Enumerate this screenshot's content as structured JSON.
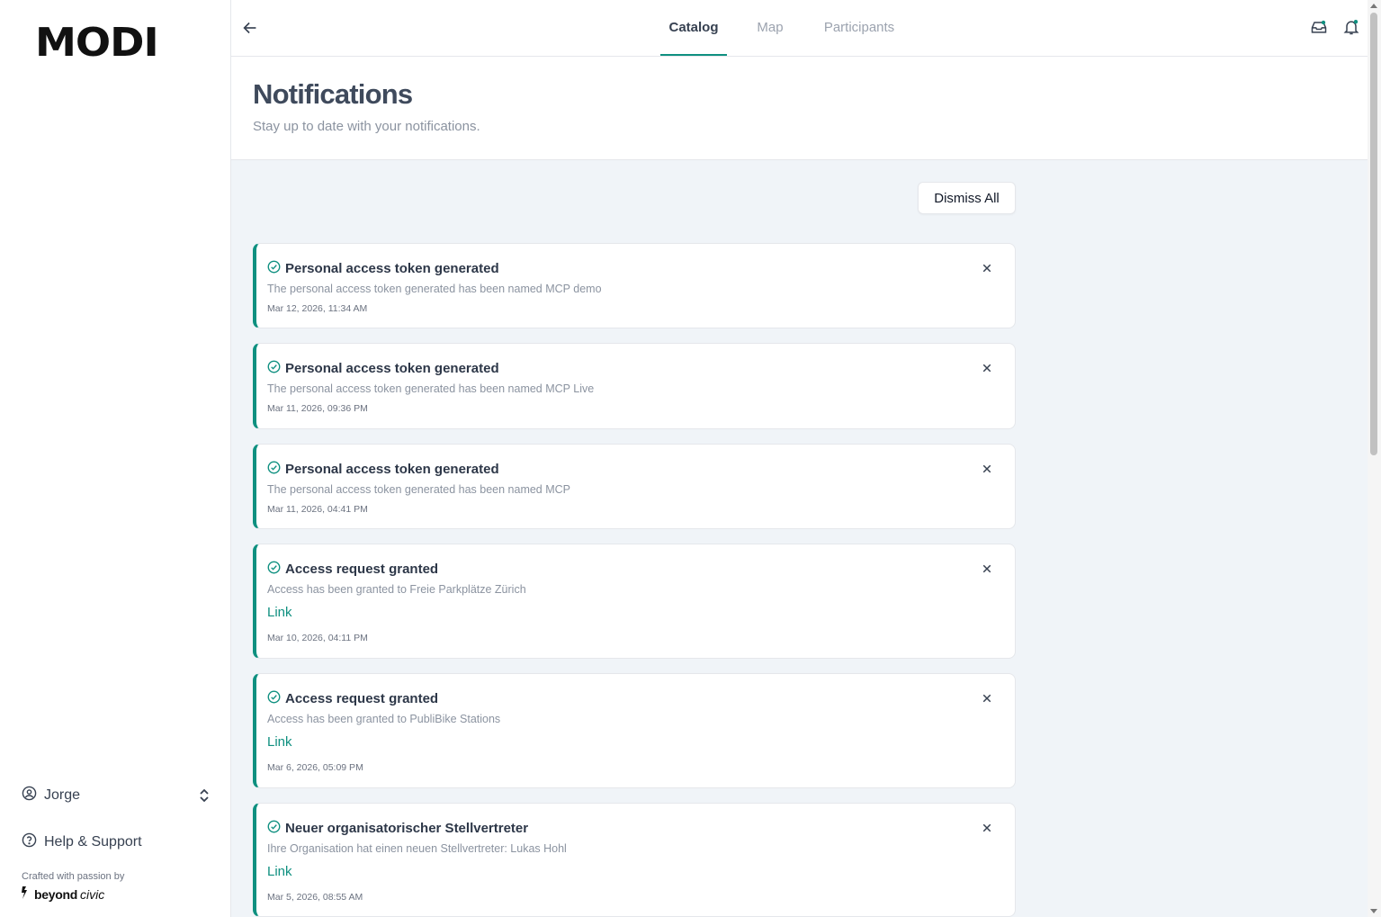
{
  "sidebar": {
    "logo": "MODI",
    "user_name": "Jorge",
    "help_label": "Help & Support",
    "crafted_by": "Crafted with passion by",
    "brand_bold": "beyond",
    "brand_italic": "civic"
  },
  "nav": {
    "tabs": [
      {
        "label": "Catalog",
        "active": true
      },
      {
        "label": "Map",
        "active": false
      },
      {
        "label": "Participants",
        "active": false
      }
    ]
  },
  "page": {
    "title": "Notifications",
    "subtitle": "Stay up to date with your notifications.",
    "dismiss_all": "Dismiss All"
  },
  "notifications": [
    {
      "title": "Personal access token generated",
      "message": "The personal access token generated has been named MCP demo",
      "link": "",
      "date": "Mar 12, 2026, 11:34 AM"
    },
    {
      "title": "Personal access token generated",
      "message": "The personal access token generated has been named MCP Live",
      "link": "",
      "date": "Mar 11, 2026, 09:36 PM"
    },
    {
      "title": "Personal access token generated",
      "message": "The personal access token generated has been named MCP",
      "link": "",
      "date": "Mar 11, 2026, 04:41 PM"
    },
    {
      "title": "Access request granted",
      "message": "Access has been granted to Freie Parkplätze Zürich",
      "link": "Link",
      "date": "Mar 10, 2026, 04:11 PM"
    },
    {
      "title": "Access request granted",
      "message": "Access has been granted to PubliBike Stations",
      "link": "Link",
      "date": "Mar 6, 2026, 05:09 PM"
    },
    {
      "title": "Neuer organisatorischer Stellvertreter",
      "message": "Ihre Organisation hat einen neuen Stellvertreter: Lukas Hohl",
      "link": "Link",
      "date": "Mar 5, 2026, 08:55 AM"
    }
  ],
  "colors": {
    "accent": "#0f9080",
    "content_bg": "#f0f4f8"
  }
}
